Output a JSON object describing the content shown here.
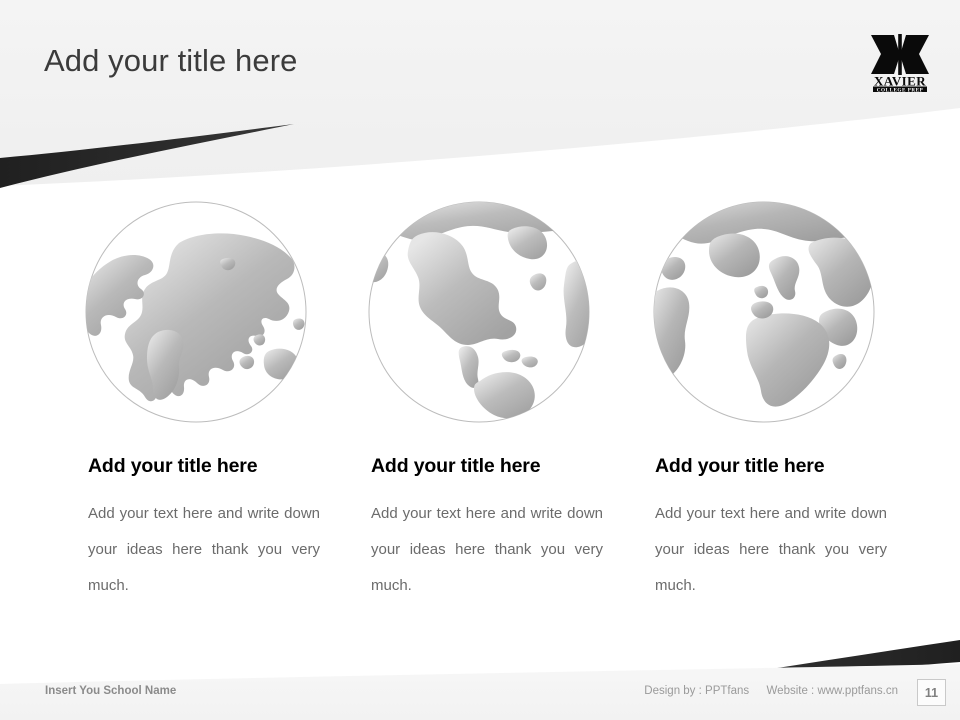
{
  "slide": {
    "title": "Add your title here",
    "page_number": "11",
    "background_color": "#ffffff",
    "header_band_color": "#f1f1f1",
    "accent_color": "#272727"
  },
  "logo": {
    "name": "xavier-college-prep-logo",
    "mark": "X",
    "line1": "XAVIER",
    "line2": "COLLEGE PREP",
    "color": "#000000"
  },
  "columns": [
    {
      "globe_icon": "globe-icon",
      "globe_view": "europe-africa-asia",
      "title": "Add your title here",
      "body": "Add your text here and write down your ideas here thank you very much."
    },
    {
      "globe_icon": "globe-icon",
      "globe_view": "americas",
      "title": "Add your title here",
      "body": "Add your text here and write down your ideas here thank you very much."
    },
    {
      "globe_icon": "globe-icon",
      "globe_view": "atlantic-europe-africa",
      "title": "Add your title here",
      "body": "Add your text here and write down your ideas here thank you very much."
    }
  ],
  "footer": {
    "school_name": "Insert You School Name",
    "design_by": "Design by : PPTfans",
    "website": "Website : www.pptfans.cn"
  }
}
